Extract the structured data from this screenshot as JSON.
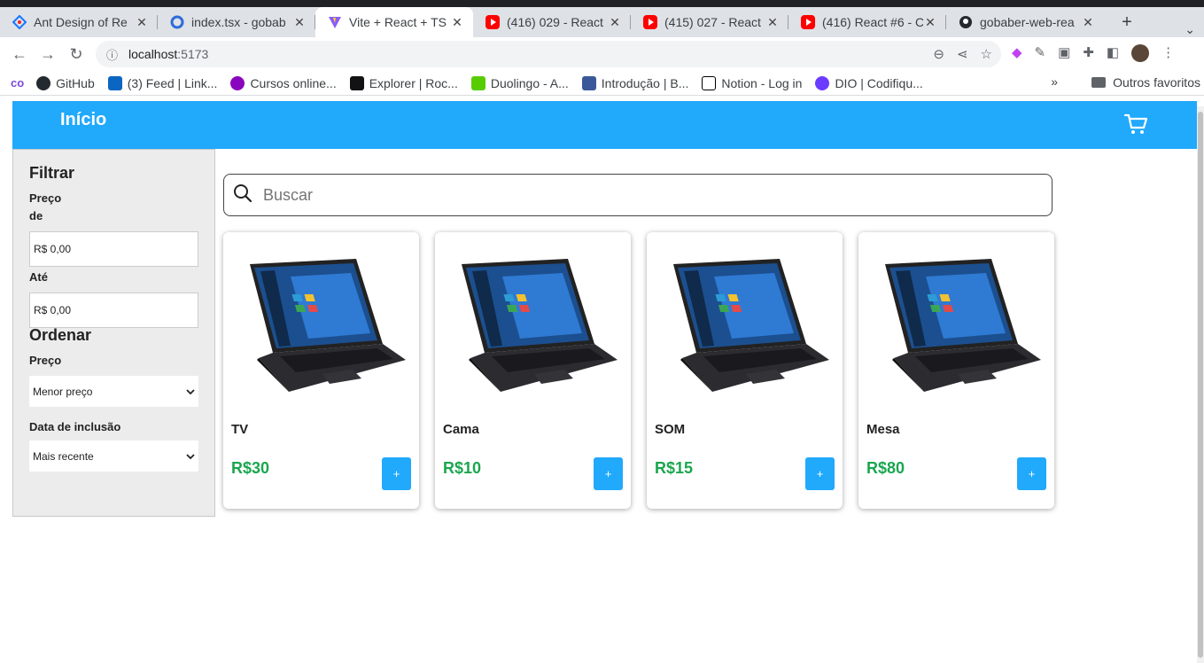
{
  "browser": {
    "tabs": [
      {
        "title": "Ant Design of Re",
        "icon": "ant-design-icon",
        "active": false
      },
      {
        "title": "index.tsx - gobab",
        "icon": "codesandbox-icon",
        "active": false
      },
      {
        "title": "Vite + React + TS",
        "icon": "vite-icon",
        "active": true
      },
      {
        "title": "(416) 029 - React",
        "icon": "youtube-icon",
        "active": false
      },
      {
        "title": "(415) 027 - React",
        "icon": "youtube-icon",
        "active": false
      },
      {
        "title": "(416) React #6 - C",
        "icon": "youtube-icon",
        "active": false
      },
      {
        "title": "gobaber-web-rea",
        "icon": "github-icon",
        "active": false
      }
    ],
    "new_tab": "+",
    "url_host": "localhost",
    "url_port": ":5173",
    "bookmarks": [
      {
        "label": "GitHub",
        "color": "#24292f"
      },
      {
        "label": "(3) Feed | Link...",
        "color": "#0a66c2"
      },
      {
        "label": "Cursos online...",
        "color": "#8a05be"
      },
      {
        "label": "Explorer | Roc...",
        "color": "#121214"
      },
      {
        "label": "Duolingo - A...",
        "color": "#58cc02"
      },
      {
        "label": "Introdução | B...",
        "color": "#3b5998"
      },
      {
        "label": "Notion - Log in",
        "color": "#000000"
      },
      {
        "label": "DIO | Codifiqu...",
        "color": "#6b3cff"
      }
    ],
    "bookmarks_more": "»",
    "other_bookmarks": "Outros favoritos"
  },
  "header": {
    "title": "Início",
    "accent": "#21a9fc"
  },
  "filter": {
    "title": "Filtrar",
    "price_label": "Preço",
    "from_label": "de",
    "from_value": "R$ 0,00",
    "to_label": "Até",
    "to_value": "R$ 0,00",
    "sort_title": "Ordenar",
    "sort_price_label": "Preço",
    "sort_price_value": "Menor preço",
    "date_label": "Data de inclusão",
    "date_value": "Mais recente"
  },
  "search": {
    "placeholder": "Buscar"
  },
  "products": [
    {
      "name": "TV",
      "price": "R$30",
      "add_label": "+"
    },
    {
      "name": "Cama",
      "price": "R$10",
      "add_label": "+"
    },
    {
      "name": "SOM",
      "price": "R$15",
      "add_label": "+"
    },
    {
      "name": "Mesa",
      "price": "R$80",
      "add_label": "+"
    }
  ]
}
